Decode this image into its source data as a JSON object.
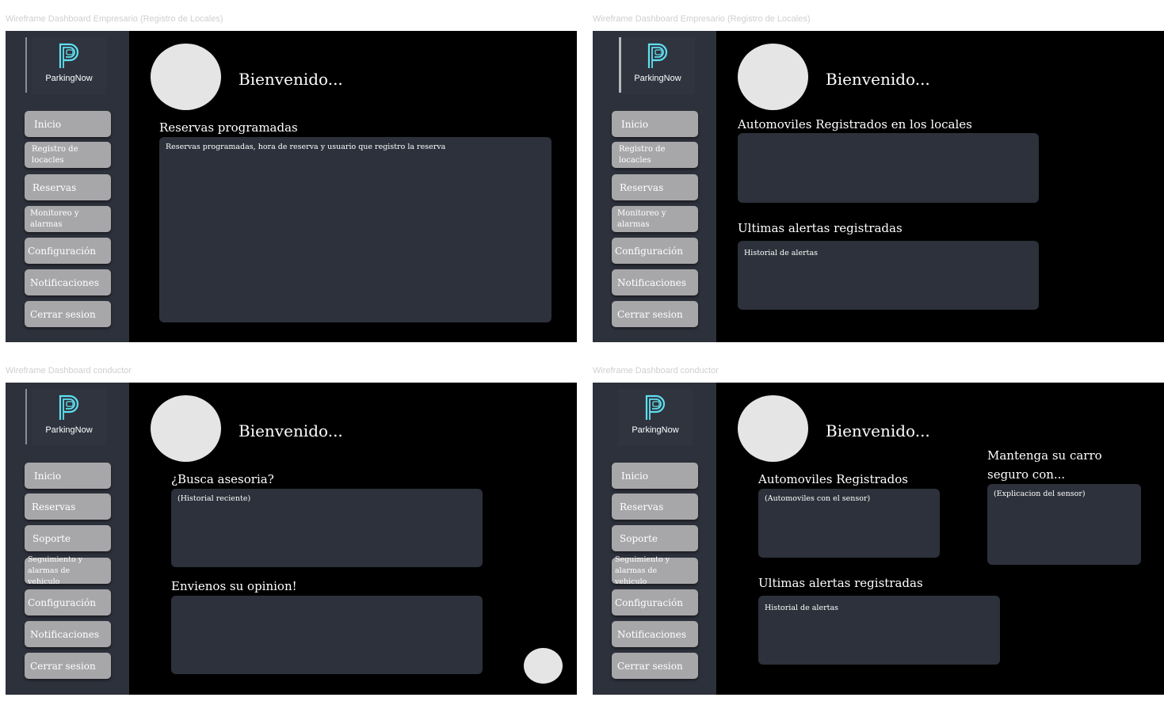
{
  "frames": [
    {
      "label": "Wireframe Dashboard Empresario (Registro de Locales)",
      "logo_text": "ParkingNow",
      "nav": [
        "Inicio",
        "Registro de locacles",
        "Reservas",
        "Monitoreo y alarmas",
        "Configuración",
        "Notificaciones",
        "Cerrar sesion"
      ],
      "welcome": "Bienvenido...",
      "sections": [
        {
          "title": "Reservas programadas",
          "text": "Reservas programadas, hora de reserva y usuario que registro la reserva"
        }
      ]
    },
    {
      "label": "Wireframe Dashboard Empresario (Registro de Locales)",
      "logo_text": "ParkingNow",
      "nav": [
        "Inicio",
        "Registro de locacles",
        "Reservas",
        "Monitoreo y alarmas",
        "Configuración",
        "Notificaciones",
        "Cerrar sesion"
      ],
      "welcome": "Bienvenido...",
      "sections": [
        {
          "title": "Automoviles Registrados en los locales",
          "text": ""
        },
        {
          "title": "Ultimas alertas registradas",
          "text": "Historial de alertas"
        }
      ]
    },
    {
      "label": "Wireframe Dashboard conductor",
      "logo_text": "ParkingNow",
      "nav": [
        "Inicio",
        "Reservas",
        "Soporte",
        "Seguimiento y alarmas de vehiculo",
        "Configuración",
        "Notificaciones",
        "Cerrar sesion"
      ],
      "welcome": "Bienvenido...",
      "sections": [
        {
          "title": "¿Busca asesoria?",
          "text": "(Historial reciente)"
        },
        {
          "title": "Envienos su opinion!",
          "text": ""
        }
      ]
    },
    {
      "label": "Wireframe Dashboard conductor",
      "logo_text": "ParkingNow",
      "nav": [
        "Inicio",
        "Reservas",
        "Soporte",
        "Seguimiento y alarmas de vehiculo",
        "Configuración",
        "Notificaciones",
        "Cerrar sesion"
      ],
      "welcome": "Bienvenido...",
      "sections": [
        {
          "title": "Automoviles Registrados",
          "text": "(Automoviles con el sensor)"
        },
        {
          "title": "Mantenga su carro seguro con...",
          "text": "(Explicacion del sensor)"
        },
        {
          "title": "Ultimas alertas registradas",
          "text": "Historial de alertas"
        }
      ]
    }
  ],
  "colors": {
    "sidebar": "#2d313b",
    "panel": "#2d313b",
    "nav_button": "#a7a7a9",
    "logo_accent": "#5fe0f0",
    "avatar": "#e5e5e5"
  },
  "icons": {
    "logo": "parking-p-car-icon",
    "avatar": "user-avatar"
  }
}
